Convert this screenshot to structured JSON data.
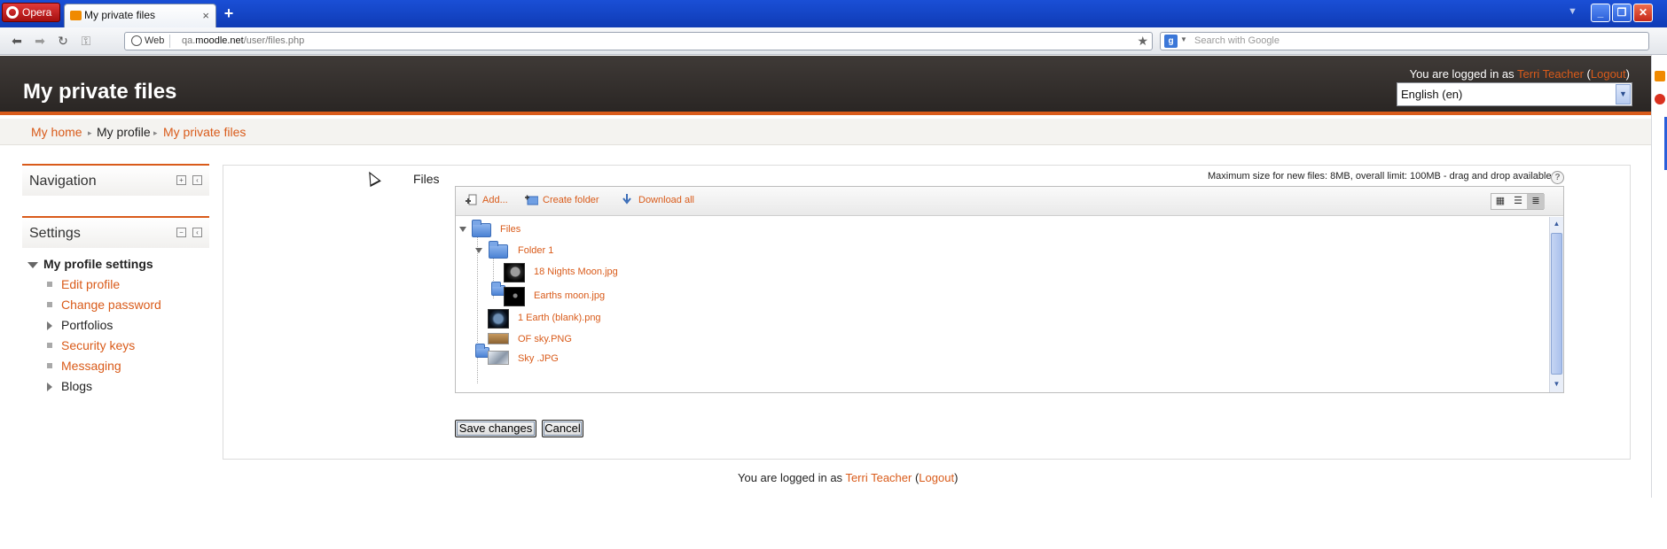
{
  "browser": {
    "menu_label": "Opera",
    "tab_title": "My private files",
    "tab_close": "×",
    "new_tab": "+",
    "address": {
      "badge": "Web",
      "url_prefix": "qa.",
      "url_host": "moodle.net",
      "url_path": "/user/files.php"
    },
    "search_placeholder": "Search with Google",
    "search_engine_glyph": "g",
    "window_controls": {
      "minimize": "_",
      "maximize": "❐",
      "close": "✕"
    }
  },
  "header": {
    "page_title": "My private files",
    "login_prefix": "You are logged in as ",
    "user_name": "Terri Teacher",
    "logout_label": "Logout",
    "language_selected": "English (en)"
  },
  "breadcrumb": {
    "items": [
      {
        "label": "My home",
        "link": true
      },
      {
        "label": "My profile",
        "link": false
      },
      {
        "label": "My private files",
        "link": true
      }
    ],
    "separator": "▸"
  },
  "blocks": {
    "navigation": {
      "title": "Navigation"
    },
    "settings": {
      "title": "Settings",
      "root_label": "My profile settings",
      "items": [
        {
          "label": "Edit profile",
          "kind": "link"
        },
        {
          "label": "Change password",
          "kind": "link"
        },
        {
          "label": "Portfolios",
          "kind": "branch"
        },
        {
          "label": "Security keys",
          "kind": "link"
        },
        {
          "label": "Messaging",
          "kind": "link"
        },
        {
          "label": "Blogs",
          "kind": "branch"
        }
      ]
    }
  },
  "filemanager": {
    "field_label": "Files",
    "max_size_note": "Maximum size for new files: 8MB, overall limit: 100MB - drag and drop available",
    "toolbar": {
      "add_label": "Add...",
      "create_folder_label": "Create folder",
      "download_all_label": "Download all"
    },
    "tree": {
      "root": "Files",
      "folder": "Folder 1",
      "folder_files": [
        "18 Nights Moon.jpg",
        "Earths moon.jpg"
      ],
      "root_files": [
        "1 Earth (blank).png",
        "OF sky.PNG",
        "Sky .JPG"
      ]
    }
  },
  "form": {
    "save_label": "Save changes",
    "cancel_label": "Cancel"
  },
  "footer": {
    "login_prefix": "You are logged in as ",
    "user_name": "Terri Teacher",
    "logout_label": "Logout"
  },
  "colors": {
    "accent": "#d95b1a",
    "header_bg": "#2f2a28",
    "titlebar": "#1a4fd6"
  }
}
